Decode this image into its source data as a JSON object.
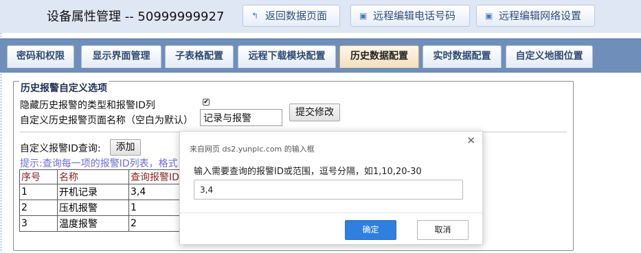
{
  "header": {
    "title": "设备属性管理 -- 50999999927",
    "buttons": [
      {
        "label": "返回数据页面",
        "icon": "return-icon"
      },
      {
        "label": "远程编辑电话号码",
        "icon": "phone-edit-icon"
      },
      {
        "label": "远程编辑网络设置",
        "icon": "network-edit-icon"
      }
    ]
  },
  "tabs": [
    {
      "label": "密码和权限"
    },
    {
      "label": "显示界面管理"
    },
    {
      "label": "子表格配置"
    },
    {
      "label": "远程下载模块配置"
    },
    {
      "label": "历史数据配置",
      "active": true
    },
    {
      "label": "实时数据配置"
    },
    {
      "label": "自定义地图位置"
    }
  ],
  "section": {
    "legend": "历史报警自定义选项",
    "hide_label": "隐藏历史报警的类型和报警ID列",
    "hide_checked": true,
    "page_name_label": "自定义历史报警页面名称（空白为默认）",
    "page_name_value": "记录与报警",
    "submit_label": "提交修改",
    "query_label": "自定义报警ID查询:",
    "add_label": "添加",
    "hint": "提示:查询每一项的报警ID列表，格式",
    "table": {
      "headers": [
        "序号",
        "名称",
        "查询报警ID"
      ],
      "rows": [
        [
          "1",
          "开机记录",
          "3,4"
        ],
        [
          "2",
          "压机报警",
          "1"
        ],
        [
          "3",
          "温度报警",
          "2"
        ]
      ]
    }
  },
  "dialog": {
    "source": "来自网页 ds2.yunplc.com 的输入框",
    "prompt": "输入需要查询的报警ID或范围，逗号分隔，如1,10,20-30",
    "input_value": "3,4",
    "ok_label": "确定",
    "cancel_label": "取消",
    "close_icon": "close-icon"
  },
  "colors": {
    "header_bg": "#dfe7f4",
    "tabbar_bg": "#6f8fba",
    "active_tab": "#f4dfbd",
    "ok_button": "#2f7fe0",
    "hint_text": "#6b6bd6",
    "table_header_text": "#8b2323"
  }
}
